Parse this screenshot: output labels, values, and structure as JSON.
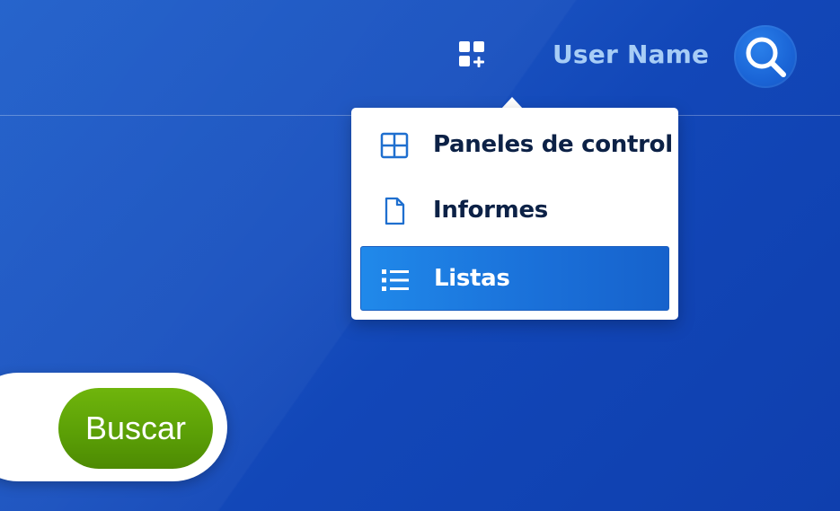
{
  "header": {
    "apps_icon": "apps-add-icon",
    "user_name": "User Name",
    "search_icon": "search-icon"
  },
  "menu": {
    "items": [
      {
        "label": "Paneles de control",
        "icon": "dashboard-grid-icon",
        "selected": false
      },
      {
        "label": "Informes",
        "icon": "document-icon",
        "selected": false
      },
      {
        "label": "Listas",
        "icon": "list-icon",
        "selected": true
      }
    ]
  },
  "search": {
    "button_label": "Buscar"
  },
  "colors": {
    "background": "#1850bf",
    "selected_item": "#1a6fd8",
    "user_name": "#a7cdf6",
    "menu_icon": "#1f6fcf",
    "buscar_button": "#5a9e06"
  }
}
